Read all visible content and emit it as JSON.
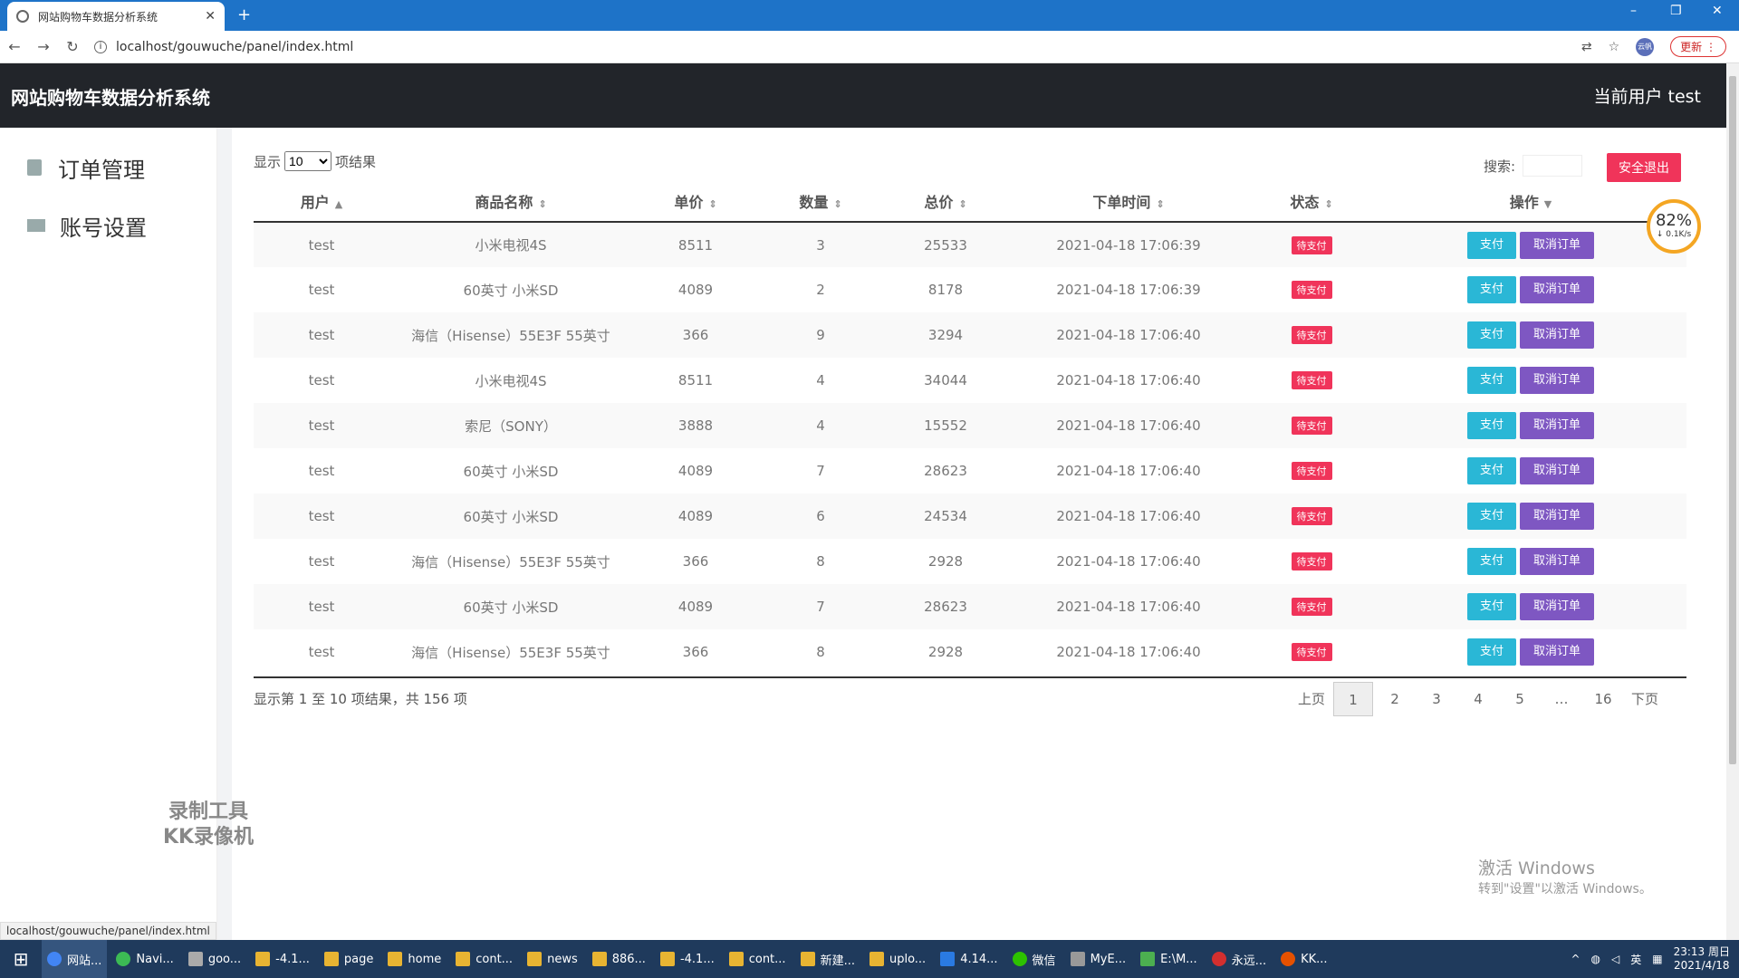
{
  "browser": {
    "tab_title": "网站购物车数据分析系统",
    "new_tab": "+",
    "url": "localhost/gouwuche/panel/index.html",
    "update_label": "更新",
    "profile_label": "云帆",
    "status_url": "localhost/gouwuche/panel/index.html",
    "window_controls": [
      "–",
      "❐",
      "✕"
    ]
  },
  "app": {
    "brand": "网站购物车数据分析系统",
    "current_user": "当前用户 test"
  },
  "sidebar": {
    "items": [
      {
        "label": "订单管理",
        "icon": "phone-icon"
      },
      {
        "label": "账号设置",
        "icon": "id-card-icon"
      }
    ]
  },
  "controls": {
    "show_prefix": "显示",
    "page_size": "10",
    "show_suffix": "项结果",
    "search_label": "搜索:",
    "logout_label": "安全退出"
  },
  "table": {
    "headers": [
      "用户",
      "商品名称",
      "单价",
      "数量",
      "总价",
      "下单时间",
      "状态",
      "操作"
    ],
    "pay_label": "支付",
    "cancel_label": "取消订单",
    "rows": [
      [
        "test",
        "小米电视4S",
        "8511",
        "3",
        "25533",
        "2021-04-18 17:06:39",
        "待支付"
      ],
      [
        "test",
        "60英寸 小米SD",
        "4089",
        "2",
        "8178",
        "2021-04-18 17:06:39",
        "待支付"
      ],
      [
        "test",
        "海信（Hisense）55E3F 55英寸",
        "366",
        "9",
        "3294",
        "2021-04-18 17:06:40",
        "待支付"
      ],
      [
        "test",
        "小米电视4S",
        "8511",
        "4",
        "34044",
        "2021-04-18 17:06:40",
        "待支付"
      ],
      [
        "test",
        "索尼（SONY）",
        "3888",
        "4",
        "15552",
        "2021-04-18 17:06:40",
        "待支付"
      ],
      [
        "test",
        "60英寸 小米SD",
        "4089",
        "7",
        "28623",
        "2021-04-18 17:06:40",
        "待支付"
      ],
      [
        "test",
        "60英寸 小米SD",
        "4089",
        "6",
        "24534",
        "2021-04-18 17:06:40",
        "待支付"
      ],
      [
        "test",
        "海信（Hisense）55E3F 55英寸",
        "366",
        "8",
        "2928",
        "2021-04-18 17:06:40",
        "待支付"
      ],
      [
        "test",
        "60英寸 小米SD",
        "4089",
        "7",
        "28623",
        "2021-04-18 17:06:40",
        "待支付"
      ],
      [
        "test",
        "海信（Hisense）55E3F 55英寸",
        "366",
        "8",
        "2928",
        "2021-04-18 17:06:40",
        "待支付"
      ]
    ]
  },
  "pagination": {
    "info": "显示第 1 至 10 项结果，共 156 项",
    "prev": "上页",
    "pages": [
      "1",
      "2",
      "3",
      "4",
      "5",
      "…",
      "16"
    ],
    "current": "1",
    "next": "下页"
  },
  "overlay": {
    "speed_percent": "82%",
    "speed_rate": "↓ 0.1K/s",
    "watermark_line1": "录制工具",
    "watermark_line2": "KK录像机",
    "activate_title": "激活 Windows",
    "activate_sub": "转到\"设置\"以激活 Windows。"
  },
  "taskbar": {
    "items": [
      "网站...",
      "Navi...",
      "goo...",
      "-4.1...",
      "page",
      "home",
      "cont...",
      "news",
      "886...",
      "-4.1...",
      "cont...",
      "新建...",
      "uplo...",
      "4.14...",
      "微信",
      "MyE...",
      "E:\\M...",
      "永远...",
      "KK..."
    ],
    "ime": "英",
    "time": "23:13 周日",
    "date": "2021/4/18"
  },
  "colors": {
    "header_bg": "#22252a",
    "danger": "#f0345a",
    "pay": "#2ab7d6",
    "cancel": "#7e57c2"
  }
}
